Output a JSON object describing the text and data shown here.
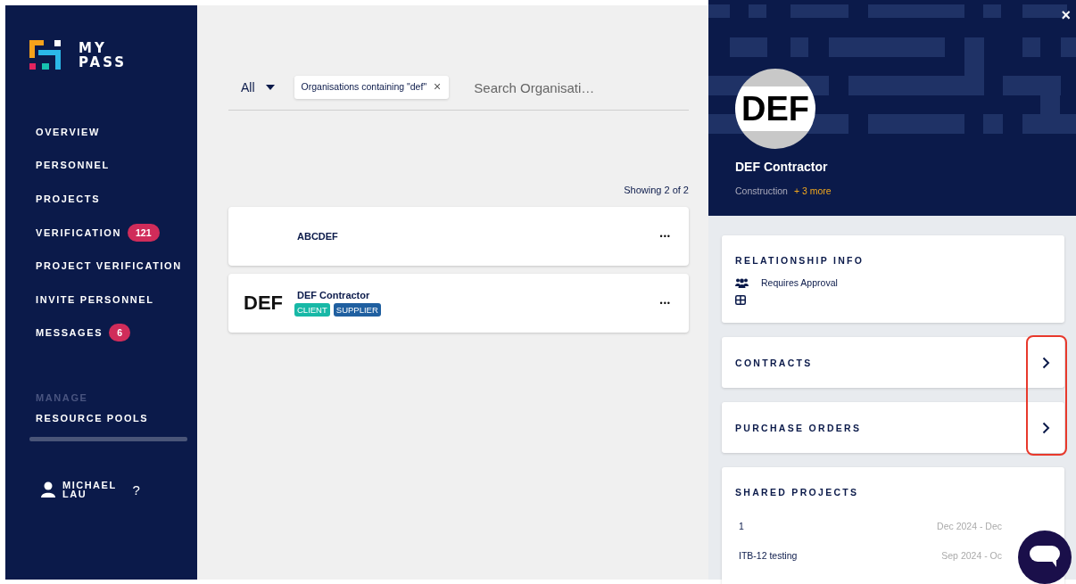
{
  "logo": {
    "line_1": "MY",
    "line_2": "PASS"
  },
  "sidebar": {
    "items": [
      {
        "label": "OVERVIEW"
      },
      {
        "label": "PERSONNEL"
      },
      {
        "label": "PROJECTS"
      },
      {
        "label": "VERIFICATION",
        "badge": "121"
      },
      {
        "label": "PROJECT VERIFICATION"
      },
      {
        "label": "INVITE PERSONNEL"
      },
      {
        "label": "MESSAGES",
        "badge": "6"
      }
    ],
    "section_title": "MANAGE",
    "section_items": [
      {
        "label": "RESOURCE POOLS"
      }
    ],
    "user": {
      "name_line_1": "MICHAEL",
      "name_line_2": "LAU",
      "help": "?"
    }
  },
  "filter": {
    "scope": "All",
    "chip": "Organisations containing \"def\"",
    "chip_close": "×",
    "search": {
      "placeholder": "Search Organisati…"
    }
  },
  "result_count": "Showing 2 of 2",
  "organisations": [
    {
      "name": "ABCDEF",
      "menu": "•••"
    },
    {
      "logo_text": "DEF",
      "name": "DEF Contractor",
      "menu": "•••",
      "tags": [
        {
          "label": "CLIENT",
          "color": "#17b8a6"
        },
        {
          "label": "SUPPLIER",
          "color": "#1f5fa0"
        }
      ]
    }
  ],
  "detail": {
    "close": "×",
    "avatar_text": "DEF",
    "name": "DEF Contractor",
    "category": "Construction",
    "more": "+ 3 more",
    "relationship": {
      "title": "RELATIONSHIP INFO",
      "status": "Requires Approval"
    },
    "links": [
      {
        "title": "CONTRACTS",
        "highlighted": true
      },
      {
        "title": "PURCHASE ORDERS",
        "highlighted": true
      }
    ],
    "shared_projects": {
      "title": "SHARED PROJECTS",
      "rows": [
        {
          "name": "1",
          "dates": "Dec 2024 - Dec"
        },
        {
          "name": "ITB-12 testing",
          "dates": "Sep 2024 - Oc"
        }
      ]
    }
  }
}
